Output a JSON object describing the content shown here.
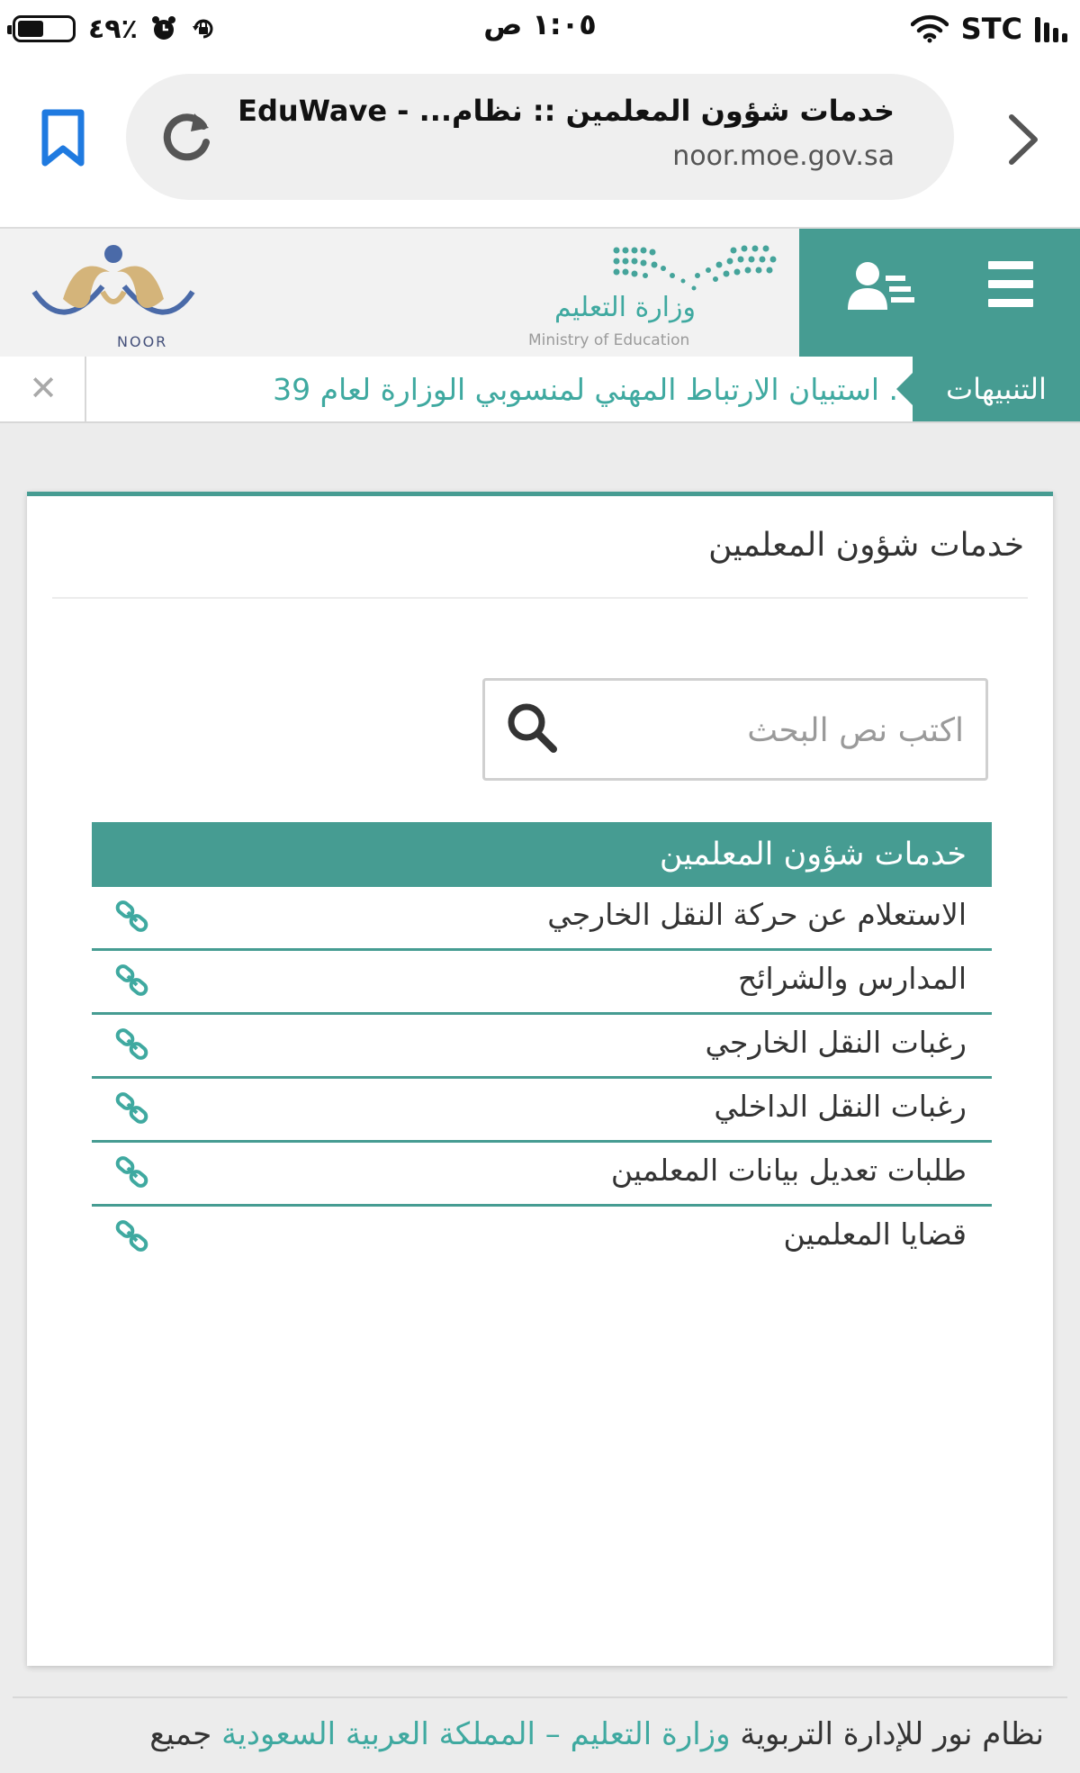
{
  "status_bar": {
    "time": "١:٠٥ ص",
    "battery_percent": "٪٤٩",
    "battery_level": 0.49,
    "carrier": "STC"
  },
  "browser": {
    "page_title": "خدمات شؤون المعلمين :: نظام... - EduWave",
    "domain": "noor.moe.gov.sa"
  },
  "header": {
    "noor_logo_text": "NOOR",
    "ministry_name_ar": "وزارة التعليم",
    "ministry_name_en": "Ministry of Education",
    "accent_color": "#469c92"
  },
  "alerts": {
    "label": "التنبيهات",
    "text": ". استبيان الارتباط المهني لمنسوبي الوزارة لعام 39",
    "close_symbol": "✕"
  },
  "main": {
    "title": "خدمات شؤون المعلمين",
    "search": {
      "placeholder": "اكتب نص البحث",
      "value": ""
    },
    "services": {
      "header": "خدمات شؤون المعلمين",
      "items": [
        {
          "label": "الاستعلام عن حركة النقل الخارجي",
          "icon": "link-icon"
        },
        {
          "label": "المدارس والشرائح",
          "icon": "link-icon"
        },
        {
          "label": "رغبات النقل الخارجي",
          "icon": "link-icon"
        },
        {
          "label": "رغبات النقل الداخلي",
          "icon": "link-icon"
        },
        {
          "label": "طلبات تعديل بيانات المعلمين",
          "icon": "link-icon"
        },
        {
          "label": "قضايا المعلمين",
          "icon": "link-icon"
        }
      ]
    }
  },
  "footer": {
    "prefix": "نظام نور للإدارة التربوية ",
    "ministry": "وزارة التعليم",
    "separator": " – ",
    "country": "المملكة العربية السعودية",
    "suffix": " جميع"
  }
}
